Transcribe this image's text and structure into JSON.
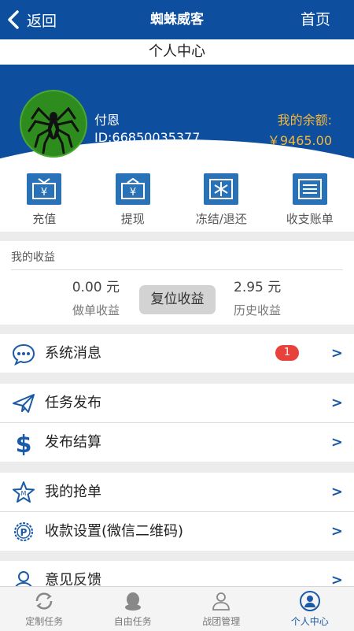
{
  "header": {
    "back_label": "返回",
    "title": "蜘蛛威客",
    "home_label": "首页"
  },
  "page_title": "个人中心",
  "profile": {
    "name": "付恩",
    "id_text": "ID:66850035377",
    "balance_label": "我的余额:",
    "balance_value": "￥9465.00"
  },
  "actions": [
    {
      "label": "充值",
      "icon": "recharge-icon"
    },
    {
      "label": "提现",
      "icon": "withdraw-icon"
    },
    {
      "label": "冻结/退还",
      "icon": "freeze-icon"
    },
    {
      "label": "收支账单",
      "icon": "bill-icon"
    }
  ],
  "earnings": {
    "heading": "我的收益",
    "order_value": "0.00 元",
    "order_label": "做单收益",
    "reset_label": "复位收益",
    "history_value": "2.95 元",
    "history_label": "历史收益"
  },
  "menu": {
    "messages": {
      "label": "系统消息",
      "badge": "1",
      "arrow": ">"
    },
    "publish": {
      "label": "任务发布",
      "arrow": ">"
    },
    "settle": {
      "label": "发布结算",
      "arrow": ">"
    },
    "grab": {
      "label": "我的抢单",
      "arrow": ">"
    },
    "payment": {
      "label": "收款设置(微信二维码)",
      "arrow": ">"
    },
    "feedback": {
      "label": "意见反馈",
      "arrow": ">"
    }
  },
  "tabs": [
    {
      "label": "定制任务",
      "icon": "refresh-icon"
    },
    {
      "label": "自由任务",
      "icon": "penguin-icon"
    },
    {
      "label": "战团管理",
      "icon": "team-icon"
    },
    {
      "label": "个人中心",
      "icon": "person-icon",
      "active": true
    }
  ],
  "colors": {
    "primary": "#0d4f9e",
    "accent": "#f6b83c",
    "badge": "#e8403a"
  }
}
